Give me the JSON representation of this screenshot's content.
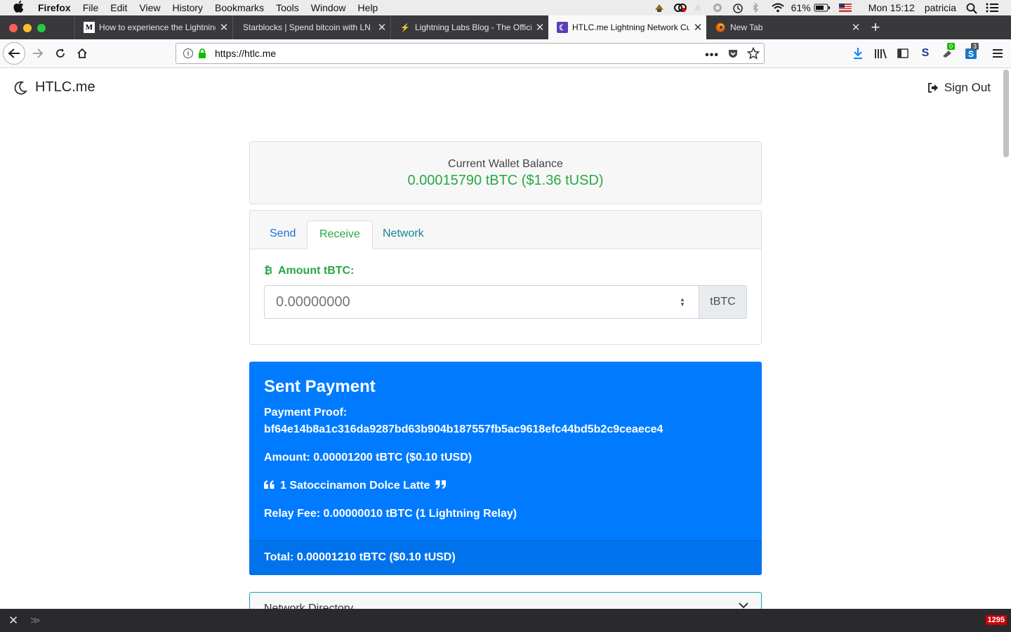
{
  "menubar": {
    "app": "Firefox",
    "items": [
      "File",
      "Edit",
      "View",
      "History",
      "Bookmarks",
      "Tools",
      "Window",
      "Help"
    ],
    "battery": "61%",
    "clock": "Mon 15:12",
    "user": "patricia"
  },
  "tabs": [
    {
      "title": "How to experience the Lightning",
      "favicon": "M"
    },
    {
      "title": "Starblocks | Spend bitcoin with LN o",
      "favicon": ""
    },
    {
      "title": "Lightning Labs Blog - The Offici",
      "favicon": "⚡"
    },
    {
      "title": "HTLC.me Lightning Network Cu",
      "favicon": "☾"
    },
    {
      "title": "New Tab",
      "favicon": ""
    }
  ],
  "browser": {
    "url": "https://htlc.me",
    "badge_green": "0",
    "badge_blue": "3"
  },
  "header": {
    "brand": "HTLC.me",
    "signout": "Sign Out"
  },
  "balance": {
    "label": "Current Wallet Balance",
    "value": "0.00015790 tBTC ($1.36 tUSD)"
  },
  "wallet_tabs": {
    "send": "Send",
    "receive": "Receive",
    "network": "Network",
    "active": "Receive"
  },
  "receive": {
    "amount_label": "Amount tBTC:",
    "amount_placeholder": "0.00000000",
    "unit": "tBTC"
  },
  "sent_payment": {
    "heading": "Sent Payment",
    "proof_label": "Payment Proof:",
    "proof": "bf64e14b8a1c316da9287bd63b904b187557fb5ac9618efc44bd5b2c9ceaece4",
    "amount": "Amount: 0.00001200 tBTC ($0.10 tUSD)",
    "memo": "1 Satoccinamon Dolce Latte",
    "relay_fee": "Relay Fee: 0.00000010 tBTC (1 Lightning Relay)",
    "total": "Total: 0.00001210 tBTC ($0.10 tUSD)"
  },
  "network_directory": {
    "label": "Network Directory"
  },
  "devtools": {
    "count": "1295"
  },
  "colors": {
    "primary": "#007bff",
    "success": "#28a745",
    "info": "#17a2b8"
  }
}
